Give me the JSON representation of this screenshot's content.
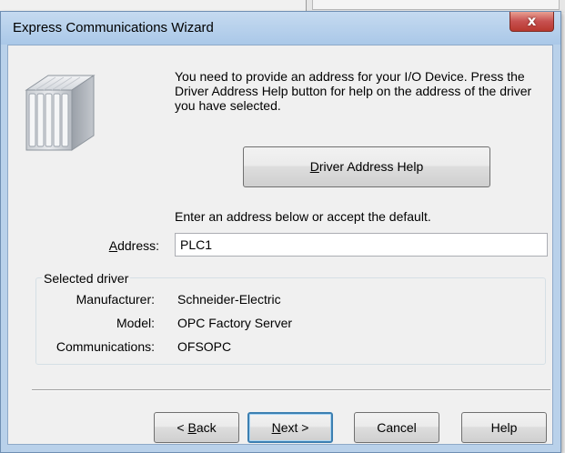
{
  "window": {
    "title": "Express Communications Wizard",
    "close_glyph": "x"
  },
  "icons": {
    "device": "io-device-icon",
    "close": "close-icon"
  },
  "intro_text": "You need to provide an address for your I/O Device. Press the Driver Address Help button for help on the address of the driver you have selected.",
  "driver_address_help_button": {
    "label": "Driver Address Help",
    "mnemonic": "D",
    "rest": "river Address Help"
  },
  "enter_address_text": "Enter an address below or accept the default.",
  "address": {
    "label": "Address:",
    "mnemonic": "A",
    "rest": "ddress:",
    "value": "PLC1"
  },
  "selected_driver": {
    "legend": "Selected driver",
    "rows": [
      {
        "key": "Manufacturer:",
        "value": "Schneider-Electric"
      },
      {
        "key": "Model:",
        "value": "OPC Factory Server"
      },
      {
        "key": "Communications:",
        "value": "OFSOPC"
      }
    ]
  },
  "buttons": {
    "back": {
      "prefix": "< ",
      "mnemonic": "B",
      "rest": "ack"
    },
    "next": {
      "mnemonic": "N",
      "rest": "ext >"
    },
    "cancel": "Cancel",
    "help": "Help"
  },
  "colors": {
    "titlebar": "#b9d1ea",
    "close_button": "#c75050",
    "default_button_border": "#3c7fb1"
  }
}
